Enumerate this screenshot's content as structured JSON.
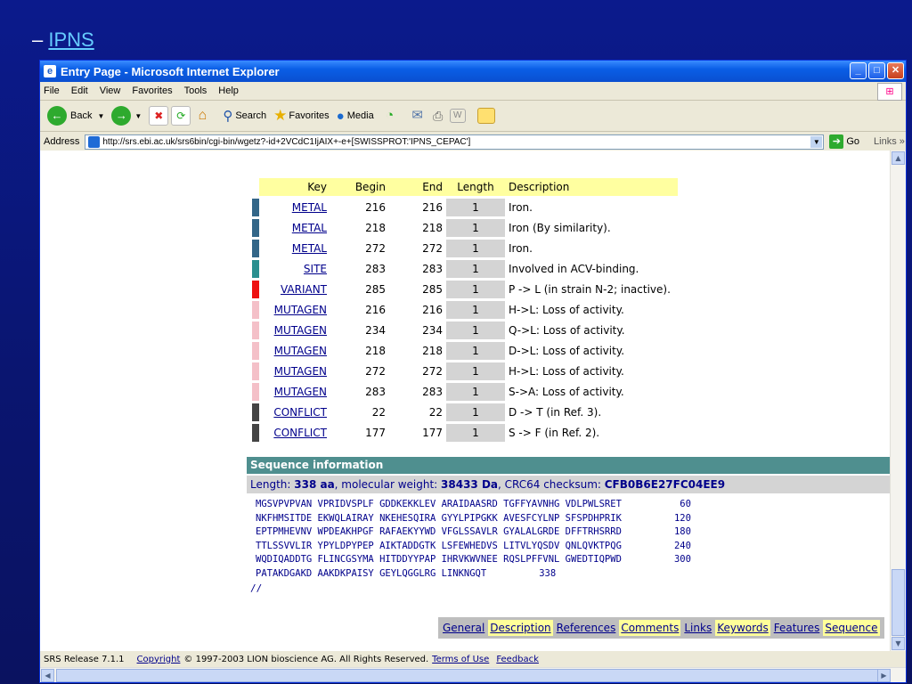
{
  "slide": {
    "bullet_prefix": "–",
    "bullet_link": "IPNS"
  },
  "window": {
    "title": "Entry Page - Microsoft Internet Explorer",
    "menu": [
      "File",
      "Edit",
      "View",
      "Favorites",
      "Tools",
      "Help"
    ],
    "toolbar": {
      "back": "Back",
      "search": "Search",
      "favorites": "Favorites",
      "media": "Media"
    },
    "address": {
      "label": "Address",
      "url": "http://srs.ebi.ac.uk/srs6bin/cgi-bin/wgetz?-id+2VCdC1IjAIX+-e+[SWISSPROT:'IPNS_CEPAC']",
      "go": "Go",
      "links": "Links"
    }
  },
  "features": {
    "headers": {
      "key": "Key",
      "begin": "Begin",
      "end": "End",
      "length": "Length",
      "description": "Description"
    },
    "rows": [
      {
        "key": "METAL",
        "begin": "216",
        "end": "216",
        "length": "1",
        "description": "Iron.",
        "color": "#336688"
      },
      {
        "key": "METAL",
        "begin": "218",
        "end": "218",
        "length": "1",
        "description": "Iron (By similarity).",
        "color": "#336688"
      },
      {
        "key": "METAL",
        "begin": "272",
        "end": "272",
        "length": "1",
        "description": "Iron.",
        "color": "#336688"
      },
      {
        "key": "SITE",
        "begin": "283",
        "end": "283",
        "length": "1",
        "description": "Involved in ACV-binding.",
        "color": "#2a9090"
      },
      {
        "key": "VARIANT",
        "begin": "285",
        "end": "285",
        "length": "1",
        "description": "P -> L (in strain N-2; inactive).",
        "color": "#ee1111"
      },
      {
        "key": "MUTAGEN",
        "begin": "216",
        "end": "216",
        "length": "1",
        "description": "H->L: Loss of activity.",
        "color": "#f4c0c8"
      },
      {
        "key": "MUTAGEN",
        "begin": "234",
        "end": "234",
        "length": "1",
        "description": "Q->L: Loss of activity.",
        "color": "#f4c0c8"
      },
      {
        "key": "MUTAGEN",
        "begin": "218",
        "end": "218",
        "length": "1",
        "description": "D->L: Loss of activity.",
        "color": "#f4c0c8"
      },
      {
        "key": "MUTAGEN",
        "begin": "272",
        "end": "272",
        "length": "1",
        "description": "H->L: Loss of activity.",
        "color": "#f4c0c8"
      },
      {
        "key": "MUTAGEN",
        "begin": "283",
        "end": "283",
        "length": "1",
        "description": "S->A: Loss of activity.",
        "color": "#f4c0c8"
      },
      {
        "key": "CONFLICT",
        "begin": "22",
        "end": "22",
        "length": "1",
        "description": "D -> T (in Ref. 3).",
        "color": "#444444"
      },
      {
        "key": "CONFLICT",
        "begin": "177",
        "end": "177",
        "length": "1",
        "description": "S -> F (in Ref. 2).",
        "color": "#444444"
      }
    ]
  },
  "sequence": {
    "heading": "Sequence information",
    "length_label": "Length: ",
    "length_value": "338 aa",
    "mw_label": ", molecular weight: ",
    "mw_value": "38433 Da",
    "crc_label": ", CRC64 checksum: ",
    "crc_value": "CFB0B6E27FC04EE9",
    "lines": [
      {
        "seq": "MGSVPVPVAN VPRIDVSPLF GDDKEKKLEV ARAIDAASRD TGFFYAVNHG VDLPWLSRET",
        "num": "60"
      },
      {
        "seq": "NKFHMSITDE EKWQLAIRAY NKEHESQIRA GYYLPIPGKK AVESFCYLNP SFSPDHPRIK",
        "num": "120"
      },
      {
        "seq": "EPTPMHEVNV WPDEAKHPGF RAFAEKYYWD VFGLSSAVLR GYALALGRDE DFFTRHSRRD",
        "num": "180"
      },
      {
        "seq": "TTLSSVVLIR YPYLDPYPEP AIKTADDGTK LSFEWHEDVS LITVLYQSDV QNLQVKTPQG",
        "num": "240"
      },
      {
        "seq": "WQDIQADDTG FLINCGSYMA HITDDYYPAP IHRVKWVNEE RQSLPFFVNL GWEDTIQPWD",
        "num": "300"
      },
      {
        "seq": "PATAKDGAKD AAKDKPAISY GEYLQGGLRG LINKNGQT",
        "num": "338"
      }
    ],
    "end_marker": "//"
  },
  "nav": [
    {
      "label": "General",
      "hl": false
    },
    {
      "label": "Description",
      "hl": true
    },
    {
      "label": "References",
      "hl": false
    },
    {
      "label": "Comments",
      "hl": true
    },
    {
      "label": "Links",
      "hl": false
    },
    {
      "label": "Keywords",
      "hl": true
    },
    {
      "label": "Features",
      "hl": false
    },
    {
      "label": "Sequence",
      "hl": true
    }
  ],
  "status": {
    "release": "SRS Release 7.1.1",
    "copyright_link": "Copyright",
    "copyright_text": "© 1997-2003 LION bioscience AG. All Rights Reserved.",
    "terms": "Terms of Use",
    "feedback": "Feedback"
  }
}
